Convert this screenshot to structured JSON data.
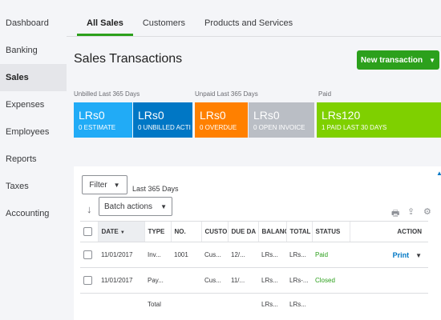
{
  "sidebar": {
    "items": [
      {
        "label": "Dashboard"
      },
      {
        "label": "Banking"
      },
      {
        "label": "Sales"
      },
      {
        "label": "Expenses"
      },
      {
        "label": "Employees"
      },
      {
        "label": "Reports"
      },
      {
        "label": "Taxes"
      },
      {
        "label": "Accounting"
      }
    ]
  },
  "tabs": [
    "All Sales",
    "Customers",
    "Products and Services"
  ],
  "page": {
    "title": "Sales Transactions",
    "new_button": "New transaction"
  },
  "summary": {
    "unbilled_label": "Unbilled Last 365 Days",
    "unpaid_label": "Unpaid Last 365 Days",
    "paid_label": "Paid",
    "cards": [
      {
        "amount": "LRs0",
        "caption": "0 ESTIMATE",
        "color": "#21abf6"
      },
      {
        "amount": "LRs0",
        "caption": "0 UNBILLED ACTI",
        "color": "#0077c5"
      },
      {
        "amount": "LRs0",
        "caption": "0 OVERDUE",
        "color": "#ff8000"
      },
      {
        "amount": "LRs0",
        "caption": "0 OPEN INVOICE",
        "color": "#babec5"
      },
      {
        "amount": "LRs120",
        "caption": "1 PAID LAST 30 DAYS",
        "color": "#7fd000"
      }
    ]
  },
  "controls": {
    "filter": "Filter",
    "last_days": "Last 365 Days",
    "batch": "Batch actions"
  },
  "table": {
    "headers": [
      "DATE",
      "TYPE",
      "NO.",
      "CUSTO",
      "DUE DA",
      "BALANC",
      "TOTAL",
      "STATUS",
      "ACTION"
    ],
    "rows": [
      {
        "date": "11/01/2017",
        "type": "Inv...",
        "no": "1001",
        "customer": "Cus...",
        "due": "12/...",
        "balance": "LRs...",
        "total": "LRs...",
        "status": "Paid",
        "action": "Print"
      },
      {
        "date": "11/01/2017",
        "type": "Pay...",
        "no": "",
        "customer": "Cus...",
        "due": "11/...",
        "balance": "LRs...",
        "total": "LRs-...",
        "status": "Closed",
        "action": ""
      }
    ],
    "total_row": {
      "label": "Total",
      "balance": "LRs...",
      "total": "LRs..."
    }
  }
}
